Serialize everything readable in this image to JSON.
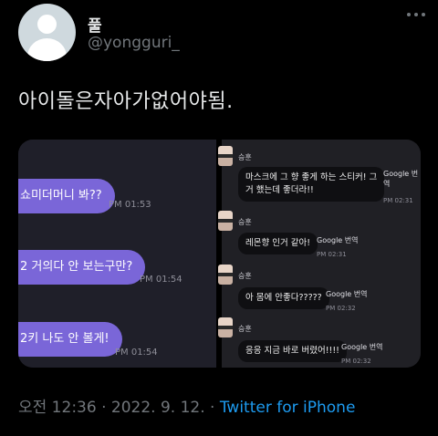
{
  "user": {
    "display_name": "풀",
    "handle": "@yongguri_"
  },
  "tweet": {
    "text": "아이돌은자아가없어야됨.",
    "time": "오전 12:36",
    "separator": "·",
    "date": "2022. 9. 12.",
    "source": "Twitter for iPhone"
  },
  "screenshot_left": {
    "messages": [
      {
        "text": "쇼미더머니 봐??",
        "time": "PM 01:53"
      },
      {
        "text": "2 거의다 안 보는구만?",
        "time": "PM 01:54"
      },
      {
        "text": "2키 나도 안 볼게!",
        "time": "PM 01:54"
      }
    ]
  },
  "screenshot_right": {
    "messages": [
      {
        "sender": "승훈",
        "text_line1": "마스크에 그 향 좋게 하는 스티커! 그",
        "text_line2": "거 했는데 좋더라!!",
        "translate": "Google 번역",
        "time": "PM 02:31"
      },
      {
        "sender": "승훈",
        "text": "레몬향 인거 같아!",
        "translate": "Google 번역",
        "time": "PM 02:31"
      },
      {
        "sender": "승훈",
        "text": "아 몸에 안좋다?????",
        "translate": "Google 번역",
        "time": "PM 02:32"
      },
      {
        "sender": "승훈",
        "text": "응응 지금 바로 버렸어!!!!",
        "translate": "Google 번역",
        "time": "PM 02:32"
      }
    ]
  }
}
